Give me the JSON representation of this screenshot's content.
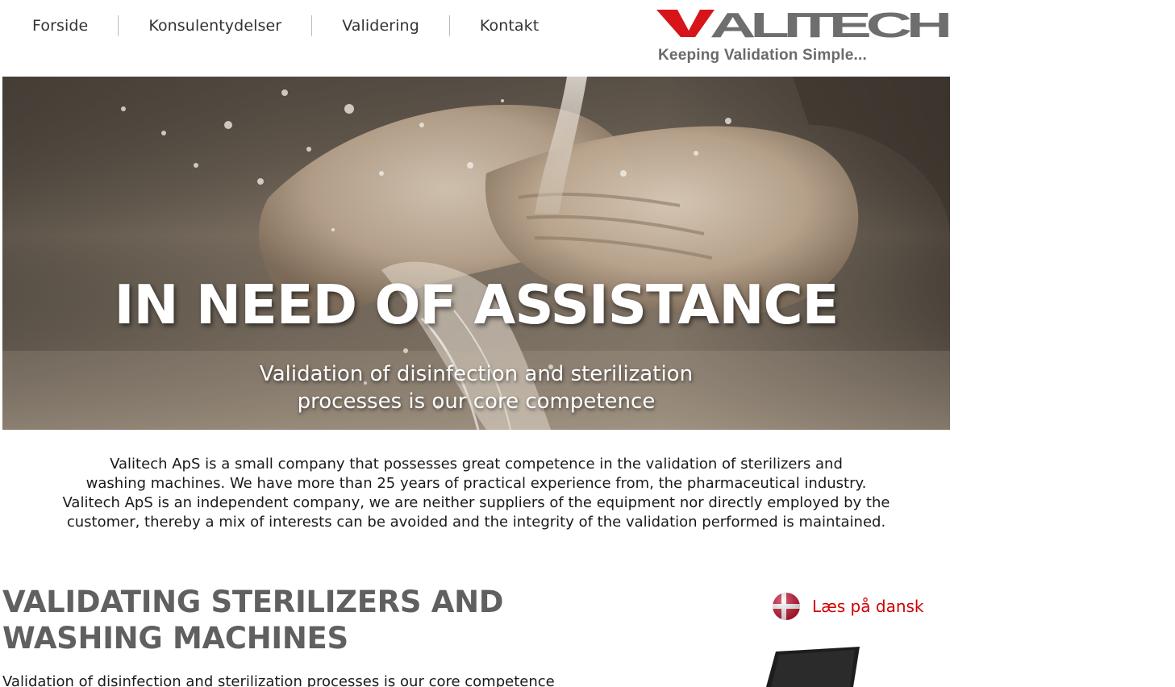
{
  "nav": {
    "items": [
      {
        "label": "Forside"
      },
      {
        "label": "Konsulentydelser"
      },
      {
        "label": "Validering"
      },
      {
        "label": "Kontakt"
      }
    ]
  },
  "logo": {
    "brand": "VALITECH",
    "tagline": "Keeping Validation Simple...",
    "colors": {
      "accent": "#d7141a",
      "gray": "#6e6e6e"
    }
  },
  "hero": {
    "title": "IN NEED OF ASSISTANCE",
    "subtitle_line1": "Validation of disinfection and sterilization",
    "subtitle_line2": "processes is our core competence"
  },
  "intro": {
    "line1": "Valitech ApS is a small company that possesses great competence in the validation of sterilizers and",
    "line2": "washing machines. We have more than 25 years of practical experience from, the pharmaceutical industry.",
    "line3": "Valitech ApS is an independent company, we are neither suppliers of the equipment nor directly employed by the",
    "line4": "customer, thereby a mix of interests can be avoided and the integrity of the validation performed is maintained."
  },
  "section": {
    "title_line1": "VALIDATING STERILIZERS AND",
    "title_line2": "WASHING MACHINES",
    "text": "Validation of disinfection and sterilization processes is our core competence"
  },
  "language": {
    "label": "Læs på dansk",
    "icon": "danish-flag-icon",
    "color": "#d20000"
  }
}
